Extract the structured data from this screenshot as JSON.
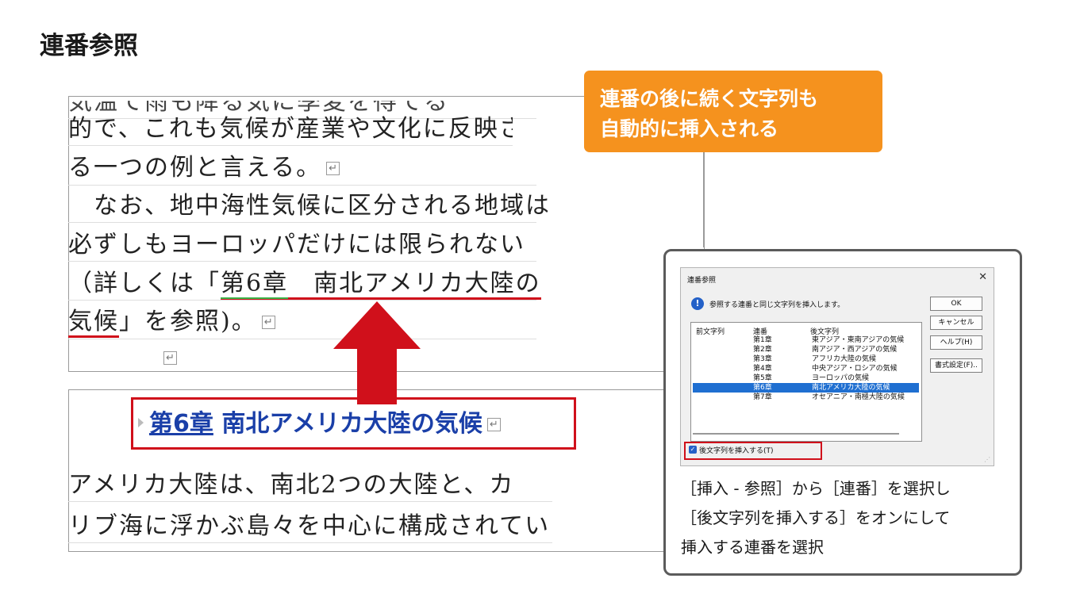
{
  "title": "連番参照",
  "top_doc": {
    "lines": [
      "気温で雨も降る気に季変を得でる",
      "的で、これも気候が産業や文化に反映さ",
      "る一つの例と言える。",
      "　なお、地中海性気候に区分される地域は",
      "必ずしもヨーロッパだけには限られない",
      "（詳しくは「",
      "第6章",
      "南北アメリカ大陸の",
      "気候",
      "」を参照)。"
    ],
    "return_mark": "↵"
  },
  "bottom_doc": {
    "heading_num": "第6章",
    "heading_text": "南北アメリカ大陸の気候",
    "lines": [
      "アメリカ大陸は、南北2つの大陸と、カ",
      "リブ海に浮かぶ島々を中心に構成されてい"
    ]
  },
  "callout": {
    "line1": "連番の後に続く文字列も",
    "line2": "自動的に挿入される",
    "color": "#f5921e"
  },
  "dialog": {
    "title": "連番参照",
    "close": "✕",
    "info_icon": "!",
    "message": "参照する連番と同じ文字列を挿入します。",
    "buttons": [
      "OK",
      "キャンセル",
      "ヘルプ(H)",
      "書式設定(F).."
    ],
    "columns": [
      "前文字列",
      "連番",
      "後文字列"
    ],
    "rows": [
      {
        "num": "第1章",
        "after": "東アジア・東南アジアの気候"
      },
      {
        "num": "第2章",
        "after": "南アジア・西アジアの気候"
      },
      {
        "num": "第3章",
        "after": "アフリカ大陸の気候"
      },
      {
        "num": "第4章",
        "after": "中央アジア・ロシアの気候"
      },
      {
        "num": "第5章",
        "after": "ヨーロッパの気候"
      },
      {
        "num": "第6章",
        "after": "南北アメリカ大陸の気候"
      },
      {
        "num": "第7章",
        "after": "オセアニア・南極大陸の気候"
      }
    ],
    "selected_row": "第6章",
    "checkbox_label": "後文字列を挿入する(T)",
    "checkbox_checked": true
  },
  "card_text": {
    "line1": "［挿入 - 参照］から［連番］を選択し",
    "line2": "［後文字列を挿入する］をオンにして",
    "line3": "挿入する連番を選択"
  },
  "accent_red": "#d0101b",
  "accent_blue": "#1a3fa8"
}
